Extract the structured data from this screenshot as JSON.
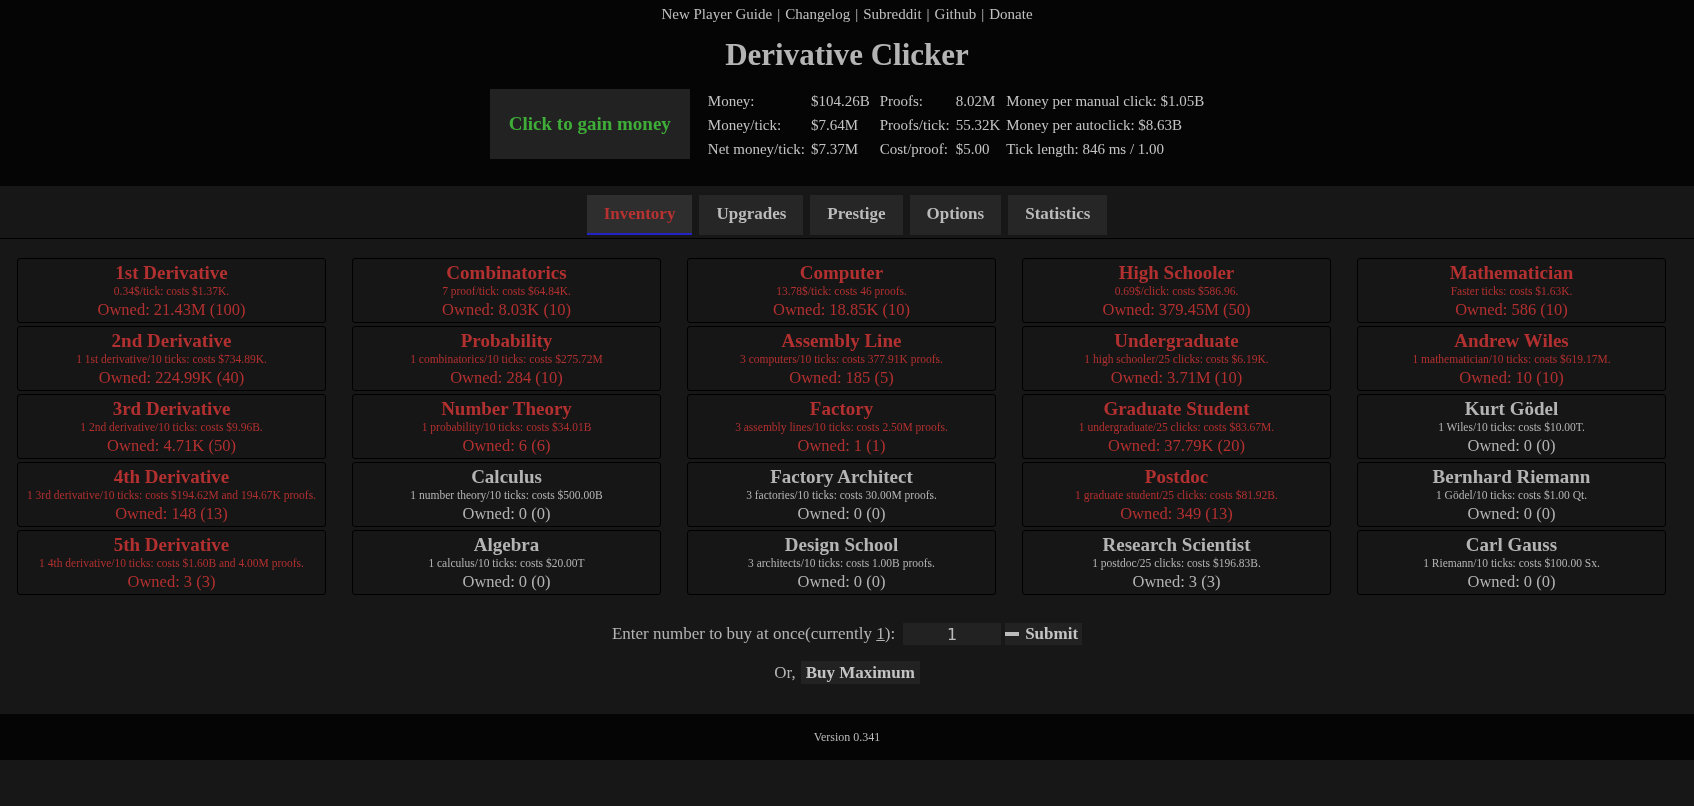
{
  "top_links": [
    "New Player Guide",
    "Changelog",
    "Subreddit",
    "Github",
    "Donate"
  ],
  "link_separator": "|",
  "title": "Derivative Clicker",
  "click_button": "Click to gain money",
  "stats": [
    {
      "label": "Money:",
      "value": "$104.26B"
    },
    {
      "label": "Money/tick:",
      "value": "$7.64M"
    },
    {
      "label": "Net money/tick:",
      "value": "$7.37M"
    },
    {
      "label": "Proofs:",
      "value": "8.02M"
    },
    {
      "label": "Proofs/tick:",
      "value": "55.32K"
    },
    {
      "label": "Cost/proof:",
      "value": "$5.00"
    },
    {
      "label": "Money per manual click:",
      "value": "$1.05B"
    },
    {
      "label": "Money per autoclick:",
      "value": "$8.63B"
    },
    {
      "label": "Tick length:",
      "value": "846 ms / 1.00"
    }
  ],
  "tabs": [
    {
      "label": "Inventory",
      "selected": true
    },
    {
      "label": "Upgrades",
      "selected": false
    },
    {
      "label": "Prestige",
      "selected": false
    },
    {
      "label": "Options",
      "selected": false
    },
    {
      "label": "Statistics",
      "selected": false
    }
  ],
  "columns": [
    [
      {
        "name": "1st Derivative",
        "desc": "0.34$/tick: costs $1.37K.",
        "owned": "Owned: 21.43M (100)",
        "affordable": true
      },
      {
        "name": "2nd Derivative",
        "desc": "1 1st derivative/10 ticks: costs $734.89K.",
        "owned": "Owned: 224.99K (40)",
        "affordable": true
      },
      {
        "name": "3rd Derivative",
        "desc": "1 2nd derivative/10 ticks: costs $9.96B.",
        "owned": "Owned: 4.71K (50)",
        "affordable": true
      },
      {
        "name": "4th Derivative",
        "desc": "1 3rd derivative/10 ticks: costs $194.62M and 194.67K proofs.",
        "owned": "Owned: 148 (13)",
        "affordable": true
      },
      {
        "name": "5th Derivative",
        "desc": "1 4th derivative/10 ticks: costs $1.60B and 4.00M proofs.",
        "owned": "Owned: 3 (3)",
        "affordable": true
      }
    ],
    [
      {
        "name": "Combinatorics",
        "desc": "7 proof/tick: costs $64.84K.",
        "owned": "Owned: 8.03K (10)",
        "affordable": true
      },
      {
        "name": "Probability",
        "desc": "1 combinatorics/10 ticks: costs $275.72M",
        "owned": "Owned: 284 (10)",
        "affordable": true
      },
      {
        "name": "Number Theory",
        "desc": "1 probability/10 ticks: costs $34.01B",
        "owned": "Owned: 6 (6)",
        "affordable": true
      },
      {
        "name": "Calculus",
        "desc": "1 number theory/10 ticks: costs $500.00B",
        "owned": "Owned: 0 (0)",
        "affordable": false
      },
      {
        "name": "Algebra",
        "desc": "1 calculus/10 ticks: costs $20.00T",
        "owned": "Owned: 0 (0)",
        "affordable": false
      }
    ],
    [
      {
        "name": "Computer",
        "desc": "13.78$/tick: costs 46 proofs.",
        "owned": "Owned: 18.85K (10)",
        "affordable": true
      },
      {
        "name": "Assembly Line",
        "desc": "3 computers/10 ticks: costs 377.91K proofs.",
        "owned": "Owned: 185 (5)",
        "affordable": true
      },
      {
        "name": "Factory",
        "desc": "3 assembly lines/10 ticks: costs 2.50M proofs.",
        "owned": "Owned: 1 (1)",
        "affordable": true
      },
      {
        "name": "Factory Architect",
        "desc": "3 factories/10 ticks: costs 30.00M proofs.",
        "owned": "Owned: 0 (0)",
        "affordable": false
      },
      {
        "name": "Design School",
        "desc": "3 architects/10 ticks: costs 1.00B proofs.",
        "owned": "Owned: 0 (0)",
        "affordable": false
      }
    ],
    [
      {
        "name": "High Schooler",
        "desc": "0.69$/click: costs $586.96.",
        "owned": "Owned: 379.45M (50)",
        "affordable": true
      },
      {
        "name": "Undergraduate",
        "desc": "1 high schooler/25 clicks: costs $6.19K.",
        "owned": "Owned: 3.71M (10)",
        "affordable": true
      },
      {
        "name": "Graduate Student",
        "desc": "1 undergraduate/25 clicks: costs $83.67M.",
        "owned": "Owned: 37.79K (20)",
        "affordable": true
      },
      {
        "name": "Postdoc",
        "desc": "1 graduate student/25 clicks: costs $81.92B.",
        "owned": "Owned: 349 (13)",
        "affordable": true
      },
      {
        "name": "Research Scientist",
        "desc": "1 postdoc/25 clicks: costs $196.83B.",
        "owned": "Owned: 3 (3)",
        "affordable": false
      }
    ],
    [
      {
        "name": "Mathematician",
        "desc": "Faster ticks: costs $1.63K.",
        "owned": "Owned: 586 (10)",
        "affordable": true
      },
      {
        "name": "Andrew Wiles",
        "desc": "1 mathematician/10 ticks: costs $619.17M.",
        "owned": "Owned: 10 (10)",
        "affordable": true
      },
      {
        "name": "Kurt Gödel",
        "desc": "1 Wiles/10 ticks: costs $10.00T.",
        "owned": "Owned: 0 (0)",
        "affordable": false
      },
      {
        "name": "Bernhard Riemann",
        "desc": "1 Gödel/10 ticks: costs $1.00 Qt.",
        "owned": "Owned: 0 (0)",
        "affordable": false
      },
      {
        "name": "Carl Gauss",
        "desc": "1 Riemann/10 ticks: costs $100.00 Sx.",
        "owned": "Owned: 0 (0)",
        "affordable": false
      }
    ]
  ],
  "buy": {
    "prompt_start": "Enter number to buy at once(currently ",
    "current": "1",
    "prompt_end": "):",
    "input_value": "1",
    "submit": "Submit",
    "or_label": "Or,",
    "max_button": "Buy Maximum"
  },
  "footer": "Version 0.341"
}
